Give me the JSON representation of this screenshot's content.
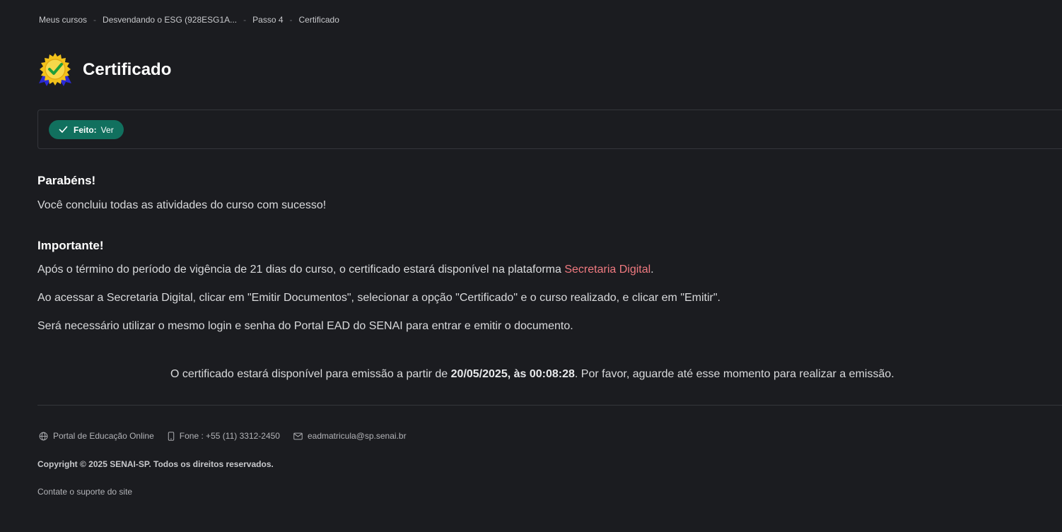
{
  "breadcrumb": {
    "items": [
      "Meus cursos",
      "Desvendando o ESG (928ESG1A...",
      "Passo 4",
      "Certificado"
    ],
    "separator": "-"
  },
  "page": {
    "title": "Certificado",
    "icon": "certificate-badge-icon"
  },
  "completion": {
    "label": "Feito:",
    "value": "Ver",
    "color": "#11705e"
  },
  "congrats": {
    "heading": "Parabéns!",
    "text": "Você concluiu todas as atividades do curso com sucesso!"
  },
  "important": {
    "heading": "Importante!",
    "line1_before": "Após o término do período de vigência de 21 dias do curso, o certificado estará disponível na plataforma ",
    "line1_link": "Secretaria Digital",
    "line1_after": ".",
    "line2": "Ao acessar a Secretaria Digital, clicar em \"Emitir Documentos\", selecionar a opção \"Certificado\" e o curso realizado, e clicar em \"Emitir\".",
    "line3": "Será necessário utilizar o mesmo login e senha do Portal EAD do SENAI para entrar e emitir o documento.",
    "link_color": "#f07a80"
  },
  "availability": {
    "before": "O certificado estará disponível para emissão a partir de ",
    "date": "20/05/2025, às 00:08:28",
    "after": ". Por favor, aguarde até esse momento para realizar a emissão."
  },
  "footer": {
    "portal": "Portal de Educação Online",
    "phone": "Fone : +55 (11) 3312-2450",
    "email": "eadmatricula@sp.senai.br",
    "copyright": "Copyright © 2025 SENAI-SP. Todos os direitos reservados.",
    "support": "Contate o suporte do site"
  }
}
